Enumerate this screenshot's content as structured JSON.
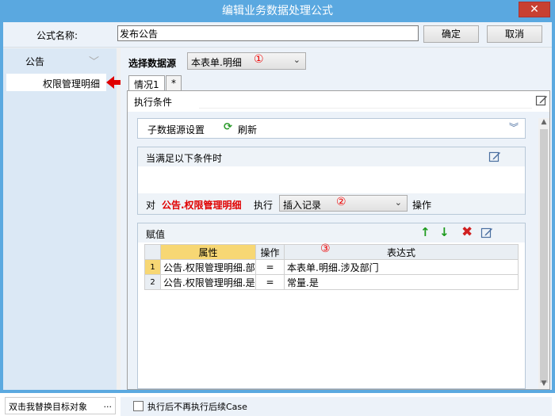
{
  "window": {
    "title": "编辑业务数据处理公式",
    "close": "✕"
  },
  "top": {
    "name_label": "公式名称:",
    "name_value": "发布公告",
    "ok_label": "确定",
    "cancel_label": "取消"
  },
  "sidebar": {
    "group_label": "公告",
    "selected_item": "权限管理明细",
    "bottom_text": "双击我替换目标对象",
    "bottom_more": "..."
  },
  "datasource": {
    "label": "选择数据源",
    "value": "本表单.明细",
    "marker": "①"
  },
  "tabs": [
    {
      "label": "情况1"
    },
    {
      "label": "*"
    }
  ],
  "condition": {
    "label": "执行条件"
  },
  "sub_ds": {
    "label": "子数据源设置",
    "refresh_label": "刷新"
  },
  "when": {
    "title": "当满足以下条件时",
    "prefix": "对",
    "target": "公告.权限管理明细",
    "exec_label": "执行",
    "action": "插入记录",
    "marker": "②",
    "suffix": "操作"
  },
  "assign": {
    "title": "赋值",
    "marker": "③",
    "headers": [
      "",
      "属性",
      "操作",
      "表达式"
    ],
    "rows": [
      {
        "num": "1",
        "prop": "公告.权限管理明细.部",
        "op": "=",
        "expr": "本表单.明细.涉及部门"
      },
      {
        "num": "2",
        "prop": "公告.权限管理明细.是",
        "op": "=",
        "expr": "常量.是"
      }
    ]
  },
  "footer": {
    "checkbox_label": "执行后不再执行后续Case"
  },
  "colors": {
    "accent": "#5aa8e0",
    "highlight_red": "#e00000",
    "header_selected": "#f7d774"
  }
}
